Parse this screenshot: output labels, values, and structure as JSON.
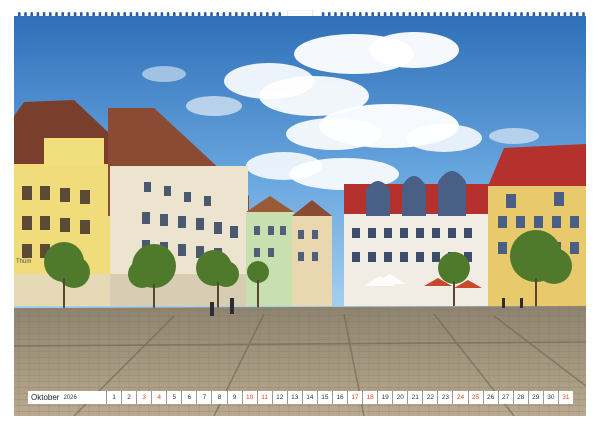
{
  "calendar": {
    "month": "Oktober",
    "year": "2026",
    "days": [
      {
        "n": "1",
        "we": false
      },
      {
        "n": "2",
        "we": false
      },
      {
        "n": "3",
        "we": true
      },
      {
        "n": "4",
        "we": true
      },
      {
        "n": "5",
        "we": false
      },
      {
        "n": "6",
        "we": false
      },
      {
        "n": "7",
        "we": false
      },
      {
        "n": "8",
        "we": false
      },
      {
        "n": "9",
        "we": false
      },
      {
        "n": "10",
        "we": true
      },
      {
        "n": "11",
        "we": true
      },
      {
        "n": "12",
        "we": false
      },
      {
        "n": "13",
        "we": false
      },
      {
        "n": "14",
        "we": false
      },
      {
        "n": "15",
        "we": false
      },
      {
        "n": "16",
        "we": false
      },
      {
        "n": "17",
        "we": true
      },
      {
        "n": "18",
        "we": true
      },
      {
        "n": "19",
        "we": false
      },
      {
        "n": "20",
        "we": false
      },
      {
        "n": "21",
        "we": false
      },
      {
        "n": "22",
        "we": false
      },
      {
        "n": "23",
        "we": false
      },
      {
        "n": "24",
        "we": true
      },
      {
        "n": "25",
        "we": true
      },
      {
        "n": "26",
        "we": false
      },
      {
        "n": "27",
        "we": false
      },
      {
        "n": "28",
        "we": false
      },
      {
        "n": "29",
        "we": false
      },
      {
        "n": "30",
        "we": false
      },
      {
        "n": "31",
        "we": true
      }
    ]
  },
  "photo": {
    "building_sign": "Thüm",
    "colors": {
      "sky_top": "#2f6fb8",
      "sky_bottom": "#8ec1ea",
      "cobblestone": "#a99b86",
      "yellow_facade": "#f0dc7a",
      "red_roof": "#b5312e",
      "weekend_red": "#d24a2a"
    }
  }
}
